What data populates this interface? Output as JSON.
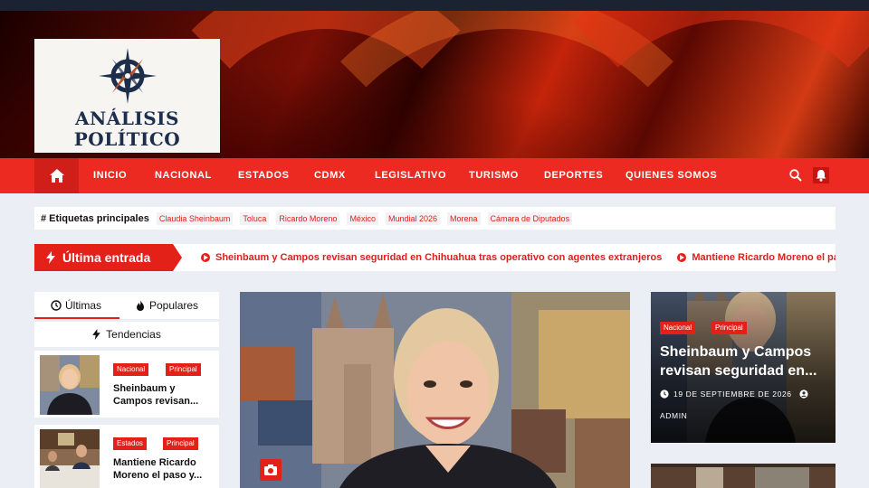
{
  "site": {
    "logo_line1": "ANÁLISIS",
    "logo_line2": "POLÍTICO",
    "colors": {
      "accent": "#e32119",
      "nav": "#ed2a22",
      "logo_navy": "#1d2e4d",
      "logo_copper": "#b5542e"
    }
  },
  "nav": {
    "home_icon": "home-icon",
    "items": [
      "INICIO",
      "NACIONAL",
      "ESTADOS",
      "CDMX",
      "LEGISLATIVO",
      "TURISMO",
      "DEPORTES",
      "QUIENES SOMOS"
    ],
    "search_icon": "search-icon",
    "bell_icon": "bell-icon"
  },
  "tags": {
    "title": "# Etiquetas principales",
    "items": [
      "Claudia Sheinbaum",
      "Toluca",
      "Ricardo Moreno",
      "México",
      "Mundial 2026",
      "Morena",
      "Cámara de Diputados"
    ]
  },
  "latest": {
    "label": "Última entrada",
    "items": [
      "Sheinbaum y Campos revisan seguridad en Chihuahua tras operativo con agentes extranjeros",
      "Mantiene Ricardo Moreno el paso"
    ]
  },
  "sidebar": {
    "tab_latest": "Últimas",
    "tab_popular": "Populares",
    "tab_trending": "Tendencias",
    "posts": [
      {
        "badges": [
          "Nacional",
          "Principal"
        ],
        "title": "Sheinbaum y Campos revisan..."
      },
      {
        "badges": [
          "Estados",
          "Principal"
        ],
        "title": "Mantiene Ricardo Moreno el paso y..."
      }
    ]
  },
  "featured": {
    "badges": [
      "Nacional",
      "Principal"
    ],
    "title": "Sheinbaum y Campos revisan seguridad en...",
    "date": "19 DE SEPTIEMBRE DE 2026",
    "author": "ADMIN"
  }
}
